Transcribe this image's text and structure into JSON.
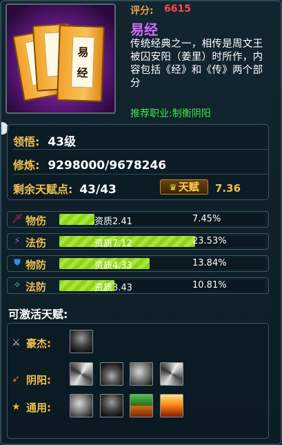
{
  "item": {
    "score_label": "评分:",
    "score": "6615",
    "name": "易经",
    "book_title": "易经",
    "description": "传统经典之一，相传是周文王被囚安阳（姜里）时所作，内容包括《经》和《传》两个部分",
    "recommend": "推荐职业:制衡阴阳",
    "icon": "book-stack-icon"
  },
  "stats": {
    "comprehension_label": "领悟:",
    "comprehension_value": "43级",
    "cultivation_label": "修炼:",
    "cultivation_value": "9298000/9678246",
    "remaining_label": "剩余天赋点:",
    "remaining_value": "43/43",
    "talent_button": "天赋",
    "talent_value": "7.36"
  },
  "attributes": [
    {
      "name": "物伤",
      "quality": "资质2.41",
      "percent": "7.45%",
      "fill": 0.17,
      "icon": "sword-icon",
      "icon_color": "#e0303a"
    },
    {
      "name": "法伤",
      "quality": "资质7.12",
      "percent": "23.53%",
      "fill": 0.66,
      "icon": "magic-wand-icon",
      "icon_color": "#b050ff"
    },
    {
      "name": "物防",
      "quality": "资质4.33",
      "percent": "13.84%",
      "fill": 0.44,
      "icon": "shield-icon",
      "icon_color": "#3a8ae0"
    },
    {
      "name": "法防",
      "quality": "资质3.43",
      "percent": "10.81%",
      "fill": 0.27,
      "icon": "magic-shield-icon",
      "icon_color": "#60c0ff"
    }
  ],
  "activatable": {
    "title": "可激活天赋:",
    "groups": [
      {
        "label": "豪杰:",
        "icon": "hero-icon",
        "icon_color": "#c8d0ff",
        "skills": [
          "dragon-head-skill-icon"
        ]
      },
      {
        "label": "阴阳:",
        "icon": "yinyang-icon",
        "icon_color": "#ff6a2a",
        "skills": [
          "whirl-skill-icon",
          "cloaked-figure-skill-icon",
          "wind-slash-skill-icon",
          "vortex-skill-icon"
        ]
      },
      {
        "label": "通用:",
        "icon": "star-icon",
        "icon_color": "#ffb81a",
        "skills": [
          "beast-skill-icon",
          "knight-skill-icon",
          "warrior-skill-icon",
          "fire-crown-skill-icon"
        ]
      }
    ]
  }
}
